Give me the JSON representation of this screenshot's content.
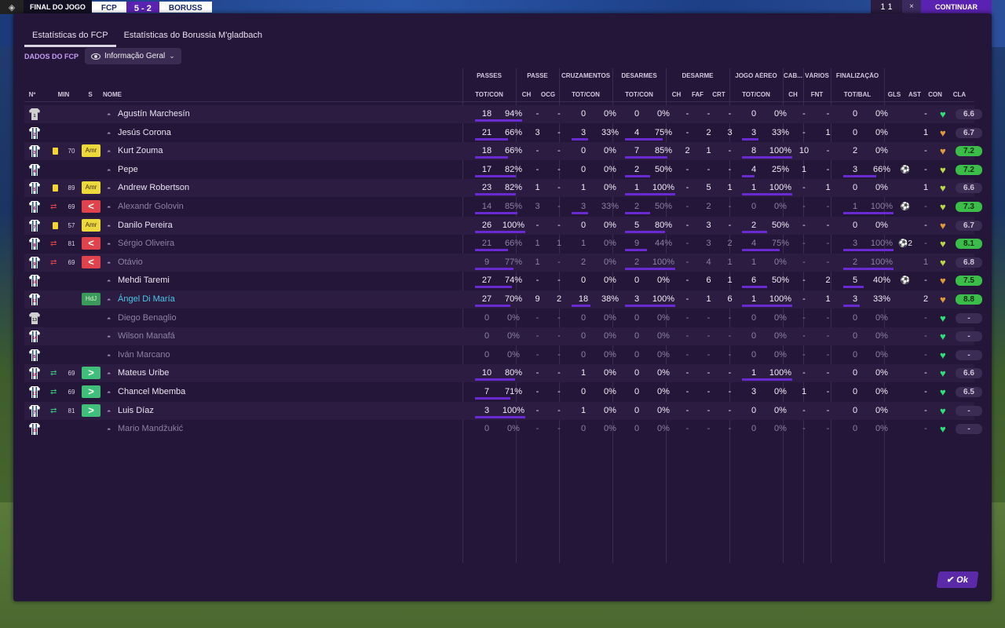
{
  "scoreboard": {
    "final_label": "FINAL DO JOGO",
    "home_team": "FCP",
    "score": "5 - 2",
    "away_team": "BORUSS",
    "right_score": "1 1",
    "right_close": "×",
    "continue_label": "CONTINUAR"
  },
  "tabs": [
    "Estatísticas do FCP",
    "Estatísticas do Borussia M'gladbach"
  ],
  "subbar": {
    "label": "DADOS DO FCP",
    "dropdown": "Informação Geral"
  },
  "groups": [
    "PASSES",
    "PASSE",
    "CRUZAMENTOS",
    "DESARMES",
    "DESARME",
    "JOGO AÉREO",
    "CAB...",
    "VÁRIOS",
    "FINALIZAÇÃO"
  ],
  "subheaders": {
    "num": "Nº",
    "min": "MIN",
    "s": "S",
    "name": "NOME",
    "passes": "TOT/CON",
    "ch1": "CH",
    "ocg": "OCG",
    "crosses": "TOT/CON",
    "tackles": "TOT/CON",
    "ch2": "CH",
    "faf": "FAF",
    "crt": "CRT",
    "aerial": "TOT/CON",
    "ch3": "CH",
    "fnt": "FNT",
    "shots": "TOT/BAL",
    "gls": "GLS",
    "ast": "AST",
    "con": "CON",
    "cla": "CLA"
  },
  "players": [
    {
      "num": "1",
      "gk": true,
      "min": "",
      "card": "",
      "sub": "",
      "status": "",
      "status_label": "",
      "name": "Agustín Marchesín",
      "dim": false,
      "cyan": false,
      "p_tot": "18",
      "p_pct": "94%",
      "ch1": "-",
      "ocg": "-",
      "c_tot": "0",
      "c_pct": "0%",
      "t_tot": "0",
      "t_pct": "0%",
      "ch2": "-",
      "faf": "-",
      "crt": "-",
      "a_tot": "0",
      "a_pct": "0%",
      "ch3": "-",
      "fnt": "-",
      "s_tot": "0",
      "s_pct": "0%",
      "gls": "",
      "ast": "-",
      "con": "green",
      "rating": "6.6",
      "rgreen": false
    },
    {
      "num": "2",
      "gk": false,
      "min": "",
      "card": "",
      "sub": "",
      "status": "",
      "status_label": "",
      "name": "Jesús Corona",
      "dim": false,
      "cyan": false,
      "p_tot": "21",
      "p_pct": "66%",
      "ch1": "3",
      "ocg": "-",
      "c_tot": "3",
      "c_pct": "33%",
      "t_tot": "4",
      "t_pct": "75%",
      "ch2": "-",
      "faf": "2",
      "crt": "3",
      "a_tot": "3",
      "a_pct": "33%",
      "ch3": "-",
      "fnt": "1",
      "s_tot": "0",
      "s_pct": "0%",
      "gls": "",
      "ast": "1",
      "con": "orange",
      "rating": "6.7",
      "rgreen": false
    },
    {
      "num": "3",
      "gk": false,
      "min": "70",
      "card": "yellow",
      "sub": "",
      "status": "amr",
      "status_label": "Amr",
      "name": "Kurt Zouma",
      "dim": false,
      "cyan": false,
      "p_tot": "18",
      "p_pct": "66%",
      "ch1": "-",
      "ocg": "-",
      "c_tot": "0",
      "c_pct": "0%",
      "t_tot": "7",
      "t_pct": "85%",
      "ch2": "2",
      "faf": "1",
      "crt": "-",
      "a_tot": "8",
      "a_pct": "100%",
      "ch3": "10",
      "fnt": "-",
      "s_tot": "2",
      "s_pct": "0%",
      "gls": "",
      "ast": "-",
      "con": "orange",
      "rating": "7.2",
      "rgreen": true
    },
    {
      "num": "4",
      "gk": false,
      "min": "",
      "card": "",
      "sub": "",
      "status": "",
      "status_label": "",
      "name": "Pepe",
      "dim": false,
      "cyan": false,
      "p_tot": "17",
      "p_pct": "82%",
      "ch1": "-",
      "ocg": "-",
      "c_tot": "0",
      "c_pct": "0%",
      "t_tot": "2",
      "t_pct": "50%",
      "ch2": "-",
      "faf": "-",
      "crt": "-",
      "a_tot": "4",
      "a_pct": "25%",
      "ch3": "1",
      "fnt": "-",
      "s_tot": "3",
      "s_pct": "66%",
      "gls": "⚽",
      "ast": "-",
      "con": "yellow",
      "rating": "7.2",
      "rgreen": true
    },
    {
      "num": "5",
      "gk": false,
      "min": "89",
      "card": "yellow",
      "sub": "",
      "status": "amr",
      "status_label": "Amr",
      "name": "Andrew Robertson",
      "dim": false,
      "cyan": false,
      "p_tot": "23",
      "p_pct": "82%",
      "ch1": "1",
      "ocg": "-",
      "c_tot": "1",
      "c_pct": "0%",
      "t_tot": "1",
      "t_pct": "100%",
      "ch2": "-",
      "faf": "5",
      "crt": "1",
      "a_tot": "1",
      "a_pct": "100%",
      "ch3": "-",
      "fnt": "1",
      "s_tot": "0",
      "s_pct": "0%",
      "gls": "",
      "ast": "1",
      "con": "yellow",
      "rating": "6.6",
      "rgreen": false
    },
    {
      "num": "6",
      "gk": false,
      "min": "69",
      "card": "",
      "sub": "out",
      "status": "out",
      "status_label": "<",
      "name": "Alexandr Golovin",
      "dim": true,
      "cyan": false,
      "p_tot": "14",
      "p_pct": "85%",
      "ch1": "3",
      "ocg": "-",
      "c_tot": "3",
      "c_pct": "33%",
      "t_tot": "2",
      "t_pct": "50%",
      "ch2": "-",
      "faf": "2",
      "crt": "-",
      "a_tot": "0",
      "a_pct": "0%",
      "ch3": "-",
      "fnt": "-",
      "s_tot": "1",
      "s_pct": "100%",
      "gls": "⚽",
      "ast": "-",
      "con": "yellow",
      "rating": "7.3",
      "rgreen": true
    },
    {
      "num": "7",
      "gk": false,
      "min": "57",
      "card": "yellow",
      "sub": "",
      "status": "amr",
      "status_label": "Amr",
      "name": "Danilo Pereira",
      "dim": false,
      "cyan": false,
      "p_tot": "26",
      "p_pct": "100%",
      "ch1": "-",
      "ocg": "-",
      "c_tot": "0",
      "c_pct": "0%",
      "t_tot": "5",
      "t_pct": "80%",
      "ch2": "-",
      "faf": "3",
      "crt": "-",
      "a_tot": "2",
      "a_pct": "50%",
      "ch3": "-",
      "fnt": "-",
      "s_tot": "0",
      "s_pct": "0%",
      "gls": "",
      "ast": "-",
      "con": "orange",
      "rating": "6.7",
      "rgreen": false
    },
    {
      "num": "8",
      "gk": false,
      "min": "81",
      "card": "",
      "sub": "out",
      "status": "out",
      "status_label": "<",
      "name": "Sérgio Oliveira",
      "dim": true,
      "cyan": false,
      "p_tot": "21",
      "p_pct": "66%",
      "ch1": "1",
      "ocg": "1",
      "c_tot": "1",
      "c_pct": "0%",
      "t_tot": "9",
      "t_pct": "44%",
      "ch2": "-",
      "faf": "3",
      "crt": "2",
      "a_tot": "4",
      "a_pct": "75%",
      "ch3": "-",
      "fnt": "-",
      "s_tot": "3",
      "s_pct": "100%",
      "gls": "⚽2",
      "ast": "-",
      "con": "yellow",
      "rating": "8.1",
      "rgreen": true
    },
    {
      "num": "9",
      "gk": false,
      "min": "69",
      "card": "",
      "sub": "out",
      "status": "out",
      "status_label": "<",
      "name": "Otávio",
      "dim": true,
      "cyan": false,
      "p_tot": "9",
      "p_pct": "77%",
      "ch1": "1",
      "ocg": "-",
      "c_tot": "2",
      "c_pct": "0%",
      "t_tot": "2",
      "t_pct": "100%",
      "ch2": "-",
      "faf": "4",
      "crt": "1",
      "a_tot": "1",
      "a_pct": "0%",
      "ch3": "-",
      "fnt": "-",
      "s_tot": "2",
      "s_pct": "100%",
      "gls": "",
      "ast": "1",
      "con": "yellow",
      "rating": "6.8",
      "rgreen": false
    },
    {
      "num": "10",
      "gk": false,
      "min": "",
      "card": "",
      "sub": "",
      "status": "",
      "status_label": "",
      "name": "Mehdi Taremi",
      "dim": false,
      "cyan": false,
      "p_tot": "27",
      "p_pct": "74%",
      "ch1": "-",
      "ocg": "-",
      "c_tot": "0",
      "c_pct": "0%",
      "t_tot": "0",
      "t_pct": "0%",
      "ch2": "-",
      "faf": "6",
      "crt": "1",
      "a_tot": "6",
      "a_pct": "50%",
      "ch3": "-",
      "fnt": "2",
      "s_tot": "5",
      "s_pct": "40%",
      "gls": "⚽",
      "ast": "-",
      "con": "orange",
      "rating": "7.5",
      "rgreen": true
    },
    {
      "num": "11",
      "gk": false,
      "min": "",
      "card": "",
      "sub": "",
      "status": "hdj",
      "status_label": "HdJ",
      "name": "Ángel Di María",
      "dim": false,
      "cyan": true,
      "p_tot": "27",
      "p_pct": "70%",
      "ch1": "9",
      "ocg": "2",
      "c_tot": "18",
      "c_pct": "38%",
      "t_tot": "3",
      "t_pct": "100%",
      "ch2": "-",
      "faf": "1",
      "crt": "6",
      "a_tot": "1",
      "a_pct": "100%",
      "ch3": "-",
      "fnt": "1",
      "s_tot": "3",
      "s_pct": "33%",
      "gls": "",
      "ast": "2",
      "con": "orange",
      "rating": "8.8",
      "rgreen": true
    },
    {
      "num": "13",
      "gk": true,
      "min": "",
      "card": "",
      "sub": "",
      "status": "",
      "status_label": "",
      "name": "Diego Benaglio",
      "dim": true,
      "cyan": false,
      "p_tot": "0",
      "p_pct": "0%",
      "ch1": "-",
      "ocg": "-",
      "c_tot": "0",
      "c_pct": "0%",
      "t_tot": "0",
      "t_pct": "0%",
      "ch2": "-",
      "faf": "-",
      "crt": "-",
      "a_tot": "0",
      "a_pct": "0%",
      "ch3": "-",
      "fnt": "-",
      "s_tot": "0",
      "s_pct": "0%",
      "gls": "",
      "ast": "-",
      "con": "green",
      "rating": "-",
      "rgreen": false
    },
    {
      "num": "14",
      "gk": false,
      "min": "",
      "card": "",
      "sub": "",
      "status": "",
      "status_label": "",
      "name": "Wilson Manafá",
      "dim": true,
      "cyan": false,
      "p_tot": "0",
      "p_pct": "0%",
      "ch1": "-",
      "ocg": "-",
      "c_tot": "0",
      "c_pct": "0%",
      "t_tot": "0",
      "t_pct": "0%",
      "ch2": "-",
      "faf": "-",
      "crt": "-",
      "a_tot": "0",
      "a_pct": "0%",
      "ch3": "-",
      "fnt": "-",
      "s_tot": "0",
      "s_pct": "0%",
      "gls": "",
      "ast": "-",
      "con": "green",
      "rating": "-",
      "rgreen": false
    },
    {
      "num": "5",
      "gk": false,
      "min": "",
      "card": "",
      "sub": "",
      "status": "",
      "status_label": "",
      "name": "Iván Marcano",
      "dim": true,
      "cyan": false,
      "p_tot": "0",
      "p_pct": "0%",
      "ch1": "-",
      "ocg": "-",
      "c_tot": "0",
      "c_pct": "0%",
      "t_tot": "0",
      "t_pct": "0%",
      "ch2": "-",
      "faf": "-",
      "crt": "-",
      "a_tot": "0",
      "a_pct": "0%",
      "ch3": "-",
      "fnt": "-",
      "s_tot": "0",
      "s_pct": "0%",
      "gls": "",
      "ast": "-",
      "con": "green",
      "rating": "-",
      "rgreen": false
    },
    {
      "num": "16",
      "gk": false,
      "min": "69",
      "card": "",
      "sub": "in",
      "status": "in",
      "status_label": ">",
      "name": "Mateus Uribe",
      "dim": false,
      "cyan": false,
      "p_tot": "10",
      "p_pct": "80%",
      "ch1": "-",
      "ocg": "-",
      "c_tot": "1",
      "c_pct": "0%",
      "t_tot": "0",
      "t_pct": "0%",
      "ch2": "-",
      "faf": "-",
      "crt": "-",
      "a_tot": "1",
      "a_pct": "100%",
      "ch3": "-",
      "fnt": "-",
      "s_tot": "0",
      "s_pct": "0%",
      "gls": "",
      "ast": "-",
      "con": "green",
      "rating": "6.6",
      "rgreen": false
    },
    {
      "num": "17",
      "gk": false,
      "min": "69",
      "card": "",
      "sub": "in",
      "status": "in",
      "status_label": ">",
      "name": "Chancel Mbemba",
      "dim": false,
      "cyan": false,
      "p_tot": "7",
      "p_pct": "71%",
      "ch1": "-",
      "ocg": "-",
      "c_tot": "0",
      "c_pct": "0%",
      "t_tot": "0",
      "t_pct": "0%",
      "ch2": "-",
      "faf": "-",
      "crt": "-",
      "a_tot": "3",
      "a_pct": "0%",
      "ch3": "1",
      "fnt": "-",
      "s_tot": "0",
      "s_pct": "0%",
      "gls": "",
      "ast": "-",
      "con": "green",
      "rating": "6.5",
      "rgreen": false
    },
    {
      "num": "7",
      "gk": false,
      "min": "81",
      "card": "",
      "sub": "in",
      "status": "in",
      "status_label": ">",
      "name": "Luis Díaz",
      "dim": false,
      "cyan": false,
      "p_tot": "3",
      "p_pct": "100%",
      "ch1": "-",
      "ocg": "-",
      "c_tot": "1",
      "c_pct": "0%",
      "t_tot": "0",
      "t_pct": "0%",
      "ch2": "-",
      "faf": "-",
      "crt": "-",
      "a_tot": "0",
      "a_pct": "0%",
      "ch3": "-",
      "fnt": "-",
      "s_tot": "0",
      "s_pct": "0%",
      "gls": "",
      "ast": "-",
      "con": "green",
      "rating": "-",
      "rgreen": false
    },
    {
      "num": "19",
      "gk": false,
      "min": "",
      "card": "",
      "sub": "",
      "status": "",
      "status_label": "",
      "name": "Mario Mandžukić",
      "dim": true,
      "cyan": false,
      "p_tot": "0",
      "p_pct": "0%",
      "ch1": "-",
      "ocg": "-",
      "c_tot": "0",
      "c_pct": "0%",
      "t_tot": "0",
      "t_pct": "0%",
      "ch2": "-",
      "faf": "-",
      "crt": "-",
      "a_tot": "0",
      "a_pct": "0%",
      "ch3": "-",
      "fnt": "-",
      "s_tot": "0",
      "s_pct": "0%",
      "gls": "",
      "ast": "-",
      "con": "green",
      "rating": "-",
      "rgreen": false
    }
  ],
  "ok_label": "Ok",
  "colors": {
    "accent": "#5a22b0",
    "bar": "#6a2ad2",
    "heart_green": "#2fe07a",
    "heart_orange": "#e09a3a",
    "heart_yellow": "#b8d84a"
  }
}
